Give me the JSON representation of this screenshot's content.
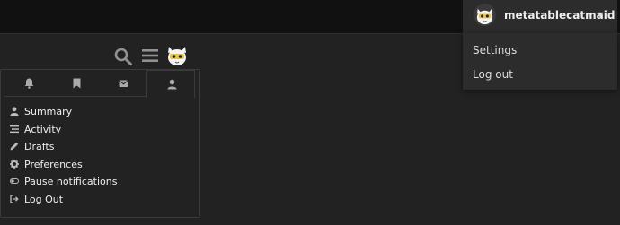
{
  "header": {
    "username": "metatablecatmaid",
    "icons": [
      "search-icon",
      "hamburger-menu-icon",
      "cat-avatar-icon"
    ]
  },
  "user_dropdown": {
    "items": [
      {
        "label": "Settings"
      },
      {
        "label": "Log out"
      }
    ]
  },
  "quick_access": {
    "tabs": [
      {
        "icon": "bell-icon",
        "active": false
      },
      {
        "icon": "bookmark-icon",
        "active": false
      },
      {
        "icon": "envelope-icon",
        "active": false
      },
      {
        "icon": "user-icon",
        "active": true
      }
    ],
    "items": [
      {
        "icon": "user-icon",
        "label": "Summary"
      },
      {
        "icon": "stream-icon",
        "label": "Activity"
      },
      {
        "icon": "pencil-icon",
        "label": "Drafts"
      },
      {
        "icon": "cog-icon",
        "label": "Preferences"
      },
      {
        "icon": "toggle-icon",
        "label": "Pause notifications"
      },
      {
        "icon": "sign-out-icon",
        "label": "Log Out"
      }
    ]
  },
  "colors": {
    "background": "#222222",
    "topbar": "#111111",
    "dropdown": "#2c2c2c",
    "avatar_yellow": "#e8c547"
  }
}
